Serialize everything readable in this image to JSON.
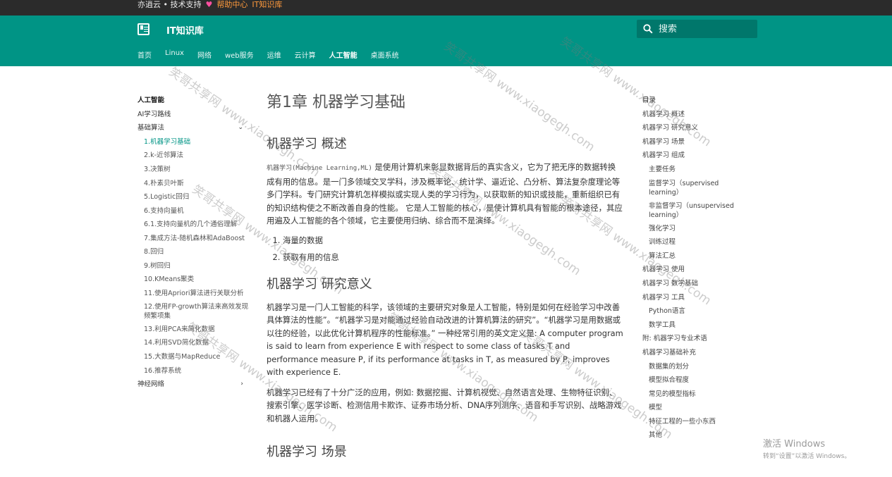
{
  "topbar": {
    "brand": "亦逍云 • 技术支持",
    "heart": "♥",
    "help": "帮助中心",
    "it": "IT知识库"
  },
  "header": {
    "title": "IT知识库",
    "search_placeholder": "搜索",
    "nav": [
      "首页",
      "Linux",
      "网络",
      "web服务",
      "运维",
      "云计算",
      "人工智能",
      "桌面系统"
    ],
    "active_nav": "人工智能"
  },
  "left_nav": {
    "heading": "人工智能",
    "items": [
      {
        "label": "AI学习路线"
      },
      {
        "label": "基础算法",
        "expanded": true
      },
      {
        "label": "1.机器学习基础",
        "active": true
      },
      {
        "label": "2.k-近邻算法"
      },
      {
        "label": "3.决策树"
      },
      {
        "label": "4.朴素贝叶斯"
      },
      {
        "label": "5.Logistic回归"
      },
      {
        "label": "6.支持向量机"
      },
      {
        "label": "6.1.支持向量机的几个通俗理解"
      },
      {
        "label": "7.集成方法-随机森林和AdaBoost"
      },
      {
        "label": "8.回归"
      },
      {
        "label": "9.树回归"
      },
      {
        "label": "10.KMeans聚类"
      },
      {
        "label": "11.使用Apriori算法进行关联分析"
      },
      {
        "label": "12.使用FP-growth算法来高效发现频繁项集"
      },
      {
        "label": "13.利用PCA来简化数据"
      },
      {
        "label": "14.利用SVD简化数据"
      },
      {
        "label": "15.大数据与MapReduce"
      },
      {
        "label": "16.推荐系统"
      },
      {
        "label": "神经网络"
      }
    ]
  },
  "article": {
    "title": "第1章 机器学习基础",
    "s1_title": "机器学习 概述",
    "s1_code": "机器学习(Machine Learning,ML)",
    "s1_p1": " 是使用计算机来彰显数据背后的真实含义，它为了把无序的数据转换成有用的信息。是一门多领域交叉学科，涉及概率论、统计学、逼近论、凸分析、算法复杂度理论等多门学科。专门研究计算机怎样模拟或实现人类的学习行为，以获取新的知识或技能，重新组织已有的知识结构使之不断改善自身的性能。 它是人工智能的核心，是使计算机具有智能的根本途径，其应用遍及人工智能的各个领域，它主要使用归纳、综合而不是演绎。",
    "s1_list": [
      "海量的数据",
      "获取有用的信息"
    ],
    "s2_title": "机器学习 研究意义",
    "s2_p1": "机器学习是一门人工智能的科学，该领域的主要研究对象是人工智能，特别是如何在经验学习中改善具体算法的性能”。“机器学习是对能通过经验自动改进的计算机算法的研究”。“机器学习是用数据或以往的经验，以此优化计算机程序的性能标准。” 一种经常引用的英文定义是: A computer program is said to learn from experience E with respect to some class of tasks T and performance measure P, if its performance at tasks in T, as measured by P, improves with experience E.",
    "s2_p2": "机器学习已经有了十分广泛的应用，例如: 数据挖掘、计算机视觉、自然语言处理、生物特征识别、搜索引擎、医学诊断、检测信用卡欺诈、证券市场分析、DNA序列测序、语音和手写识别、战略游戏和机器人运用。",
    "s3_title": "机器学习 场景"
  },
  "toc": {
    "heading": "目录",
    "items": [
      {
        "label": "机器学习 概述",
        "level": 1
      },
      {
        "label": "机器学习 研究意义",
        "level": 1
      },
      {
        "label": "机器学习 场景",
        "level": 1
      },
      {
        "label": "机器学习 组成",
        "level": 1
      },
      {
        "label": "主要任务",
        "level": 2
      },
      {
        "label": "监督学习（supervised learning）",
        "level": 2
      },
      {
        "label": "非监督学习（unsupervised learning）",
        "level": 2
      },
      {
        "label": "强化学习",
        "level": 2
      },
      {
        "label": "训练过程",
        "level": 2
      },
      {
        "label": "算法汇总",
        "level": 2
      },
      {
        "label": "机器学习 使用",
        "level": 1
      },
      {
        "label": "机器学习 数学基础",
        "level": 1
      },
      {
        "label": "机器学习 工具",
        "level": 1
      },
      {
        "label": "Python语言",
        "level": 2
      },
      {
        "label": "数学工具",
        "level": 2
      },
      {
        "label": "附: 机器学习专业术语",
        "level": 1
      },
      {
        "label": "机器学习基础补充",
        "level": 1
      },
      {
        "label": "数据集的划分",
        "level": 2
      },
      {
        "label": "模型拟合程度",
        "level": 2
      },
      {
        "label": "常见的模型指标",
        "level": 2
      },
      {
        "label": "模型",
        "level": 2
      },
      {
        "label": "特征工程的一些小东西",
        "level": 2
      },
      {
        "label": "其他",
        "level": 2
      }
    ]
  },
  "watermark": {
    "text": "笑哥共享网 www.xiaogegh.com"
  },
  "windows": {
    "line1": "激活 Windows",
    "line2": "转到“设置”以激活 Windows。"
  },
  "colors": {
    "header": "#009485",
    "topbar": "#2b2b2b",
    "active_link": "#009485"
  }
}
